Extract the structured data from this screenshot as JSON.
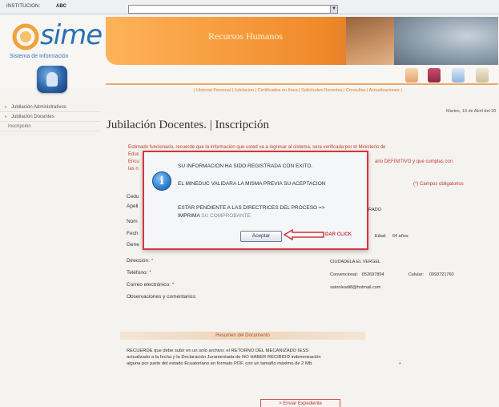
{
  "topbar": {
    "institution_label": "INSTITUCION:",
    "institution_value": "ABC"
  },
  "header": {
    "logo_text": "sime",
    "logo_subtitle": "Sistema de Información",
    "banner_title": "Recursos Humanos"
  },
  "nav": {
    "links": "| Historial Personal | Jubilacion | Certificados en línea | Solicitudes Docentes | Consultas | Actualizaciones |"
  },
  "sidebar": {
    "items": [
      {
        "label": "Jubilación Administrativos"
      },
      {
        "label": "Jubilación Docentes"
      },
      {
        "label": "Inscripción"
      }
    ]
  },
  "date": "Martes, 19 de Abril del 20",
  "page_title": "Jubilación Docentes. | Inscripción",
  "form": {
    "warning": "Estimado funcionario, recuerde que la información que usted va a ingresar al sistema, sera verificada por el Ministerio de",
    "warning2": "Educ",
    "warning3": "Encu",
    "warning3_right": "ario DEFINITIVO y que cumplas con",
    "warning4": "las n",
    "required_note": "(*) Campos obligatorios",
    "labels": {
      "ced": "Cedu",
      "apellido": "Apell",
      "nombre": "Nom",
      "fecha": "Fech",
      "genero": "Gene",
      "direccion": "Dirección:",
      "telefono": "Teléfono:",
      "correo": "Correo electrónico:",
      "observaciones": "Observaciones y comentarios:"
    },
    "values": {
      "estado_right": "RADO",
      "edad_label": "Edad:",
      "edad_value": "64 años",
      "ciudad": "CIUDADELA EL VERGEL",
      "convencional_label": "Convencional:",
      "convencional_value": "052697894",
      "celular_label": "Celular:",
      "celular_value": "0993721760",
      "email": "xatonleadi8@hotmail.com"
    }
  },
  "dialog": {
    "line1": "SU INFORMACION HA SIDO REGISTRADA CON EXITO.",
    "line2": "EL MINEDUC VALIDARA LA MISMA PREVIA SU ACEPTACION",
    "line3": "ESTAR PENDIENTE A LAS DIRECTRICES DEL PROCESO =>",
    "line4a": "IMPRIMA",
    "line4b": "SU COMPROBANTE",
    "button": "Aceptar"
  },
  "annotation": {
    "label": "DAR CLICK",
    "color": "#d0343a"
  },
  "summary": {
    "heading": "Resumen del Documento",
    "text": "RECUERDE que debe subir en un solo archivo: el RETORNO DEL MECANIZADO IESS actualizado a la fecha y la Declaración Juramentada de NO HABER RECIBIDO indemnización alguna por parte del estado Ecuatoriano en formato PDF, con un tamaño máximo de 2 Mb.",
    "bottom_button": "> Enviar Expediente"
  }
}
